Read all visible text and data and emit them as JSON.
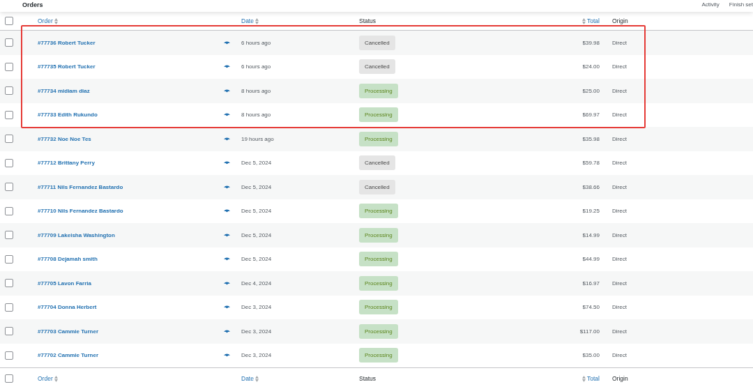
{
  "page_title": "Orders",
  "header_links": [
    "Activity",
    "Finish set"
  ],
  "select_all_checked": false,
  "columns": {
    "order": "Order",
    "date": "Date",
    "status": "Status",
    "total": "Total",
    "origin": "Origin"
  },
  "footer_columns": {
    "order": "Order",
    "date": "Date",
    "status": "Status",
    "total": "Total",
    "origin": "Origin"
  },
  "footer_select_all_checked": false,
  "rows": [
    {
      "checked": false,
      "order": "#77736 Robert Tucker",
      "date": "6 hours ago",
      "status": {
        "kind": "cancelled",
        "label": "Cancelled"
      },
      "total": "$39.98",
      "origin": "Direct",
      "highlighted": true
    },
    {
      "checked": false,
      "order": "#77735 Robert Tucker",
      "date": "6 hours ago",
      "status": {
        "kind": "cancelled",
        "label": "Cancelled"
      },
      "total": "$24.00",
      "origin": "Direct",
      "highlighted": true
    },
    {
      "checked": false,
      "order": "#77734 midiam diaz",
      "date": "8 hours ago",
      "status": {
        "kind": "processing",
        "label": "Processing"
      },
      "total": "$25.00",
      "origin": "Direct",
      "highlighted": true
    },
    {
      "checked": false,
      "order": "#77733 Edith Rukundo",
      "date": "8 hours ago",
      "status": {
        "kind": "processing",
        "label": "Processing"
      },
      "total": "$69.97",
      "origin": "Direct",
      "highlighted": true
    },
    {
      "checked": false,
      "order": "#77732 Noe Noe Tes",
      "date": "19 hours ago",
      "status": {
        "kind": "processing",
        "label": "Processing"
      },
      "total": "$35.98",
      "origin": "Direct",
      "highlighted": false
    },
    {
      "checked": false,
      "order": "#77712 Brittany Perry",
      "date": "Dec 5, 2024",
      "status": {
        "kind": "cancelled",
        "label": "Cancelled"
      },
      "total": "$59.78",
      "origin": "Direct",
      "highlighted": false
    },
    {
      "checked": false,
      "order": "#77711 Nils Fernandez Bastardo",
      "date": "Dec 5, 2024",
      "status": {
        "kind": "cancelled",
        "label": "Cancelled"
      },
      "total": "$38.66",
      "origin": "Direct",
      "highlighted": false
    },
    {
      "checked": false,
      "order": "#77710 Nils Fernandez Bastardo",
      "date": "Dec 5, 2024",
      "status": {
        "kind": "processing",
        "label": "Processing"
      },
      "total": "$19.25",
      "origin": "Direct",
      "highlighted": false
    },
    {
      "checked": false,
      "order": "#77709 Lakeisha Washington",
      "date": "Dec 5, 2024",
      "status": {
        "kind": "processing",
        "label": "Processing"
      },
      "total": "$14.99",
      "origin": "Direct",
      "highlighted": false
    },
    {
      "checked": false,
      "order": "#77708 Dejamah smith",
      "date": "Dec 5, 2024",
      "status": {
        "kind": "processing",
        "label": "Processing"
      },
      "total": "$44.99",
      "origin": "Direct",
      "highlighted": false
    },
    {
      "checked": false,
      "order": "#77705 Lavon Farria",
      "date": "Dec 4, 2024",
      "status": {
        "kind": "processing",
        "label": "Processing"
      },
      "total": "$16.97",
      "origin": "Direct",
      "highlighted": false
    },
    {
      "checked": false,
      "order": "#77704 Donna Herbert",
      "date": "Dec 3, 2024",
      "status": {
        "kind": "processing",
        "label": "Processing"
      },
      "total": "$74.50",
      "origin": "Direct",
      "highlighted": false
    },
    {
      "checked": false,
      "order": "#77703 Cammie Turner",
      "date": "Dec 3, 2024",
      "status": {
        "kind": "processing",
        "label": "Processing"
      },
      "total": "$117.00",
      "origin": "Direct",
      "highlighted": false
    },
    {
      "checked": false,
      "order": "#77702 Cammie Turner",
      "date": "Dec 3, 2024",
      "status": {
        "kind": "processing",
        "label": "Processing"
      },
      "total": "$35.00",
      "origin": "Direct",
      "highlighted": false
    }
  ]
}
